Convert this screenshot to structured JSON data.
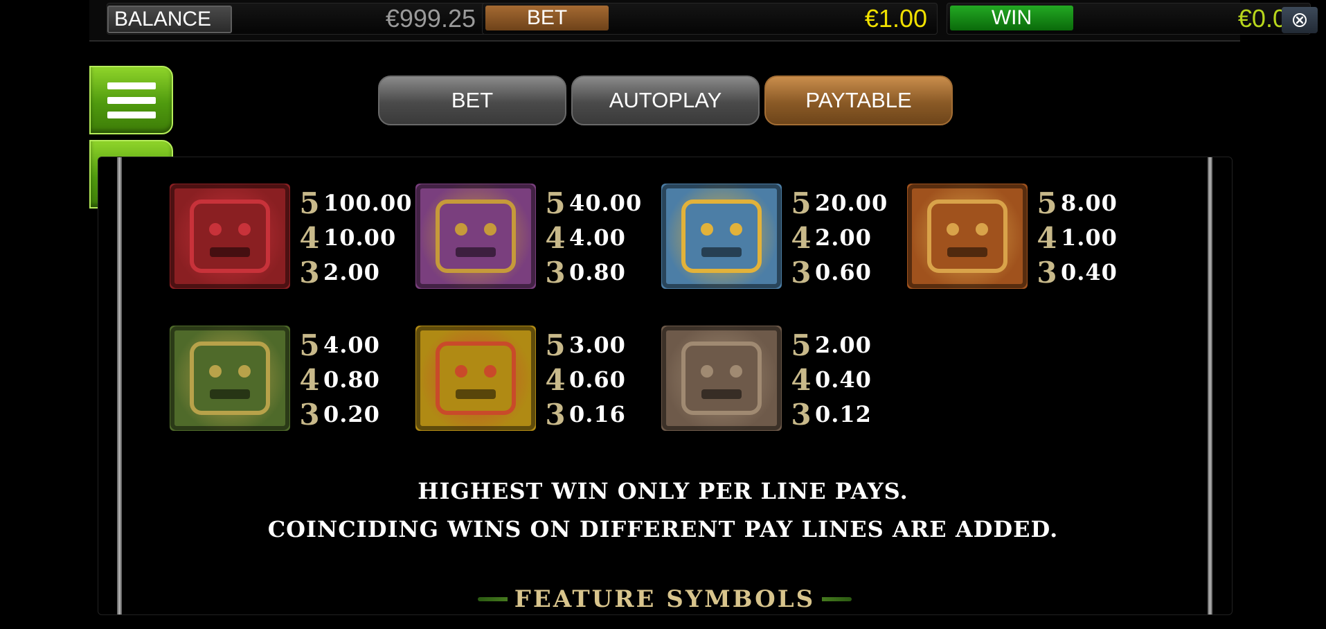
{
  "topbar": {
    "balance_label": "BALANCE",
    "balance_value": "€999.25",
    "bet_label": "BET",
    "bet_value": "€1.00",
    "win_label": "WIN",
    "win_value": "€0.00"
  },
  "tabs": [
    {
      "label": "BET",
      "active": false
    },
    {
      "label": "AUTOPLAY",
      "active": false
    },
    {
      "label": "PAYTABLE",
      "active": true
    }
  ],
  "paytable": [
    {
      "symbol": "red-totem-mask",
      "colors": [
        "#8a1f22",
        "#c8323a"
      ],
      "pays": [
        {
          "count": "5",
          "value": "100.00"
        },
        {
          "count": "4",
          "value": "10.00"
        },
        {
          "count": "3",
          "value": "2.00"
        }
      ]
    },
    {
      "symbol": "purple-gold-head",
      "colors": [
        "#7a3f7e",
        "#c69a3a"
      ],
      "pays": [
        {
          "count": "5",
          "value": "40.00"
        },
        {
          "count": "4",
          "value": "4.00"
        },
        {
          "count": "3",
          "value": "0.80"
        }
      ]
    },
    {
      "symbol": "blue-headdress-mask",
      "colors": [
        "#4c7ea6",
        "#e2b23a"
      ],
      "pays": [
        {
          "count": "5",
          "value": "20.00"
        },
        {
          "count": "4",
          "value": "2.00"
        },
        {
          "count": "3",
          "value": "0.60"
        }
      ]
    },
    {
      "symbol": "orange-sun-disc",
      "colors": [
        "#a0521d",
        "#d9a34a"
      ],
      "pays": [
        {
          "count": "5",
          "value": "8.00"
        },
        {
          "count": "4",
          "value": "1.00"
        },
        {
          "count": "3",
          "value": "0.40"
        }
      ]
    },
    {
      "symbol": "green-serpent",
      "colors": [
        "#4f6a2a",
        "#b8a24a"
      ],
      "pays": [
        {
          "count": "5",
          "value": "4.00"
        },
        {
          "count": "4",
          "value": "0.80"
        },
        {
          "count": "3",
          "value": "0.20"
        }
      ]
    },
    {
      "symbol": "yellow-sun-face",
      "colors": [
        "#b08a14",
        "#c94a2a"
      ],
      "pays": [
        {
          "count": "5",
          "value": "3.00"
        },
        {
          "count": "4",
          "value": "0.60"
        },
        {
          "count": "3",
          "value": "0.16"
        }
      ]
    },
    {
      "symbol": "stone-warrior-disc",
      "colors": [
        "#6e5a4a",
        "#a08a72"
      ],
      "pays": [
        {
          "count": "5",
          "value": "2.00"
        },
        {
          "count": "4",
          "value": "0.40"
        },
        {
          "count": "3",
          "value": "0.12"
        }
      ]
    }
  ],
  "rules": {
    "line1": "HIGHEST WIN ONLY PER LINE PAYS.",
    "line2": "COINCIDING WINS ON DIFFERENT PAY LINES ARE ADDED."
  },
  "feature_heading": "FEATURE SYMBOLS",
  "colors": {
    "bet_value": "#f0e000",
    "win_value": "#b8d61c",
    "active_tab": "#a46e34",
    "green_button": "#4f9a0e"
  },
  "icons": {
    "close": "close-circle-icon",
    "menu": "hamburger-menu-icon",
    "back": "arrow-left-icon"
  }
}
